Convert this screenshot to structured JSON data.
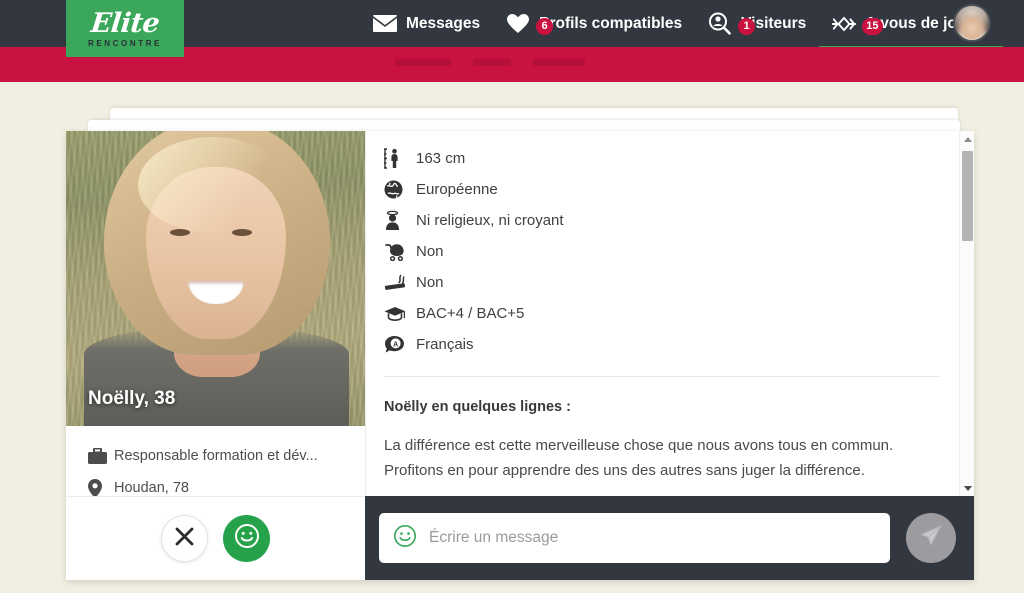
{
  "navbar": {
    "logo": {
      "name": "Elite",
      "subtitle": "RENCONTRE"
    },
    "items": [
      {
        "label": "Messages",
        "icon": "envelope-icon",
        "badge": "",
        "active": false
      },
      {
        "label": "Profils compatibles",
        "icon": "heart-icon",
        "badge": "6",
        "active": false
      },
      {
        "label": "Visiteurs",
        "icon": "visitor-search-icon",
        "badge": "1",
        "active": false
      },
      {
        "label": "A vous de jouer !",
        "icon": "target-arrow-icon",
        "badge": "15",
        "active": true
      }
    ],
    "avatar_alt": "user-avatar"
  },
  "colors": {
    "navbar_bg": "#333740",
    "red_bar": "#c9123f",
    "brand_green": "#3aa75a",
    "like_green": "#26a34a",
    "page_bg": "#f2efe2"
  },
  "profile": {
    "name_age": "Noëlly, 38",
    "job": "Responsable formation et dév...",
    "location": "Houdan, 78",
    "job_icon": "briefcase-icon",
    "location_icon": "map-pin-icon",
    "attributes": [
      {
        "icon": "height-ruler-icon",
        "value": "163 cm"
      },
      {
        "icon": "globe-icon",
        "value": "Européenne"
      },
      {
        "icon": "religion-person-icon",
        "value": "Ni religieux, ni croyant"
      },
      {
        "icon": "stroller-icon",
        "value": "Non"
      },
      {
        "icon": "cigarette-icon",
        "value": "Non"
      },
      {
        "icon": "graduation-cap-icon",
        "value": "BAC+4 / BAC+5"
      },
      {
        "icon": "speech-bubble-language-icon",
        "value": "Français"
      }
    ],
    "bio_title": "Noëlly en quelques lignes :",
    "bio_text": "La différence est cette merveilleuse chose que nous avons tous en commun. Profitons en pour apprendre des uns des autres sans juger la différence."
  },
  "actions": {
    "reject_icon": "close-x-icon",
    "like_icon": "smiley-icon"
  },
  "message_bar": {
    "emoji_icon": "smiley-icon",
    "placeholder": "Écrire un message",
    "send_icon": "paper-plane-icon"
  },
  "scrollbar": {
    "up_icon": "chevron-up-icon",
    "down_icon": "chevron-down-icon"
  }
}
